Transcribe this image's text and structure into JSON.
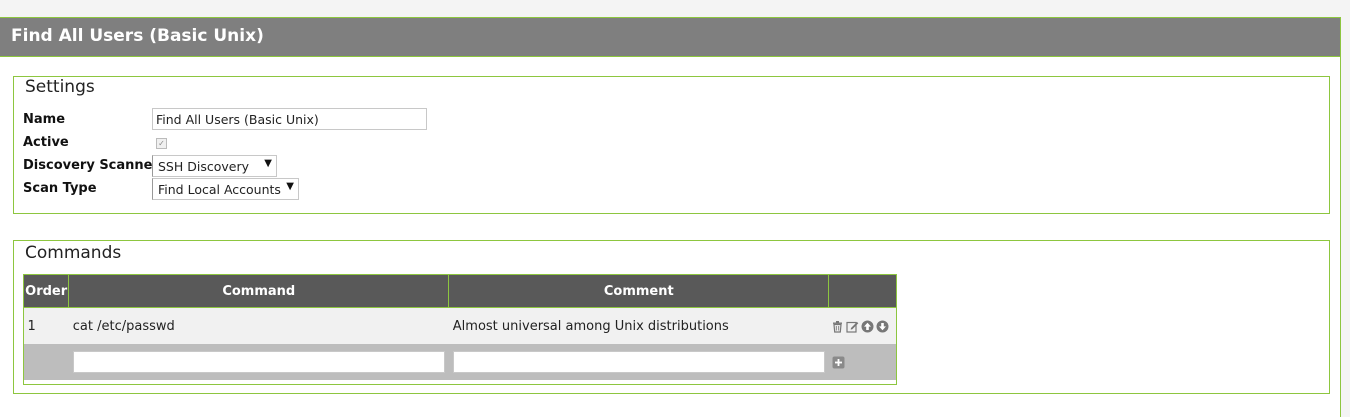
{
  "header": {
    "title": "Find All Users (Basic Unix)"
  },
  "settings": {
    "legend": "Settings",
    "name_label": "Name",
    "name_value": "Find All Users (Basic Unix)",
    "active_label": "Active",
    "active_checked": true,
    "scanner_label": "Discovery Scanner",
    "scanner_value": "SSH Discovery",
    "scan_type_label": "Scan Type",
    "scan_type_value": "Find Local Accounts"
  },
  "commands": {
    "legend": "Commands",
    "columns": {
      "order": "Order",
      "command": "Command",
      "comment": "Comment",
      "actions": ""
    },
    "rows": [
      {
        "order": "1",
        "command": "cat /etc/passwd",
        "comment": "Almost universal among Unix distributions"
      }
    ],
    "new_command_value": "",
    "new_comment_value": ""
  },
  "icons": {
    "delete": "trash-icon",
    "edit": "edit-icon",
    "move_up": "arrow-up-circle-icon",
    "move_down": "arrow-down-circle-icon",
    "add": "plus-square-icon"
  },
  "colors": {
    "header_bg": "#7f7f7f",
    "table_header_bg": "#595959",
    "accent_border": "#8dc63f",
    "new_row_bg": "#bdbdbd"
  }
}
